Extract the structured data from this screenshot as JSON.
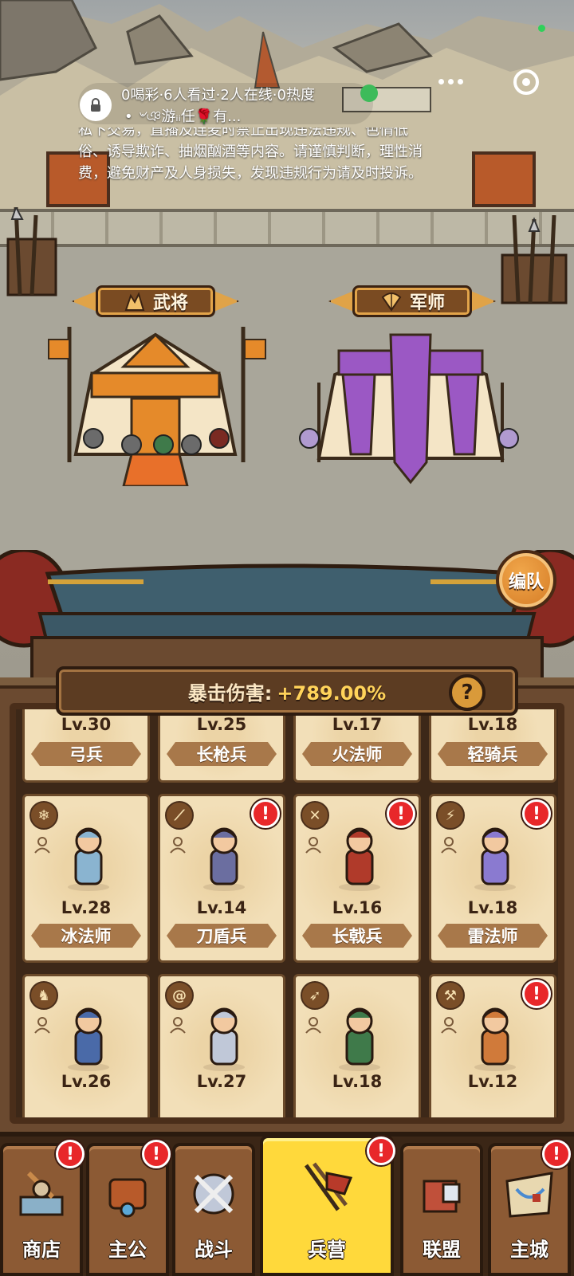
{
  "live": {
    "stats": "0喝彩·6人看过·2人在线·0热度",
    "sub": "• ৺ঞ游ᵢᵢ任🌹有...",
    "notice": "私下交易，直播及连麦时禁止出现违法违规、色情低俗、诱导欺诈、抽烟酗酒等内容。请谨慎判断，理性消费，避免财产及人身损失，发现违规行为请及时投诉。"
  },
  "scene": {
    "general_banner": "武将",
    "advisor_banner": "军师",
    "formation_button": "编队"
  },
  "crit": {
    "label": "暴击伤害:",
    "value": "+789.00%",
    "help": "?"
  },
  "units": [
    {
      "level": "Lv.30",
      "name": "弓兵"
    },
    {
      "level": "Lv.25",
      "name": "长枪兵"
    },
    {
      "level": "Lv.17",
      "name": "火法师"
    },
    {
      "level": "Lv.18",
      "name": "轻骑兵"
    },
    {
      "level": "Lv.28",
      "name": "冰法师",
      "type_icon": "snowflake-icon",
      "alert": false
    },
    {
      "level": "Lv.14",
      "name": "刀盾兵",
      "type_icon": "blade-icon",
      "alert": true
    },
    {
      "level": "Lv.16",
      "name": "长戟兵",
      "type_icon": "crossed-spears-icon",
      "alert": true
    },
    {
      "level": "Lv.18",
      "name": "雷法师",
      "type_icon": "lightning-icon",
      "alert": true
    },
    {
      "level": "Lv.26",
      "type_icon": "horse-icon",
      "alert": false
    },
    {
      "level": "Lv.27",
      "type_icon": "swirl-icon",
      "alert": false
    },
    {
      "level": "Lv.18",
      "type_icon": "crossbow-icon",
      "alert": false
    },
    {
      "level": "Lv.12",
      "type_icon": "axe-icon",
      "alert": true
    }
  ],
  "alert_mark": "!",
  "nav": [
    {
      "label": "商店",
      "icon": "shop-icon",
      "alert": true
    },
    {
      "label": "主公",
      "icon": "lord-icon",
      "alert": true
    },
    {
      "label": "战斗",
      "icon": "crossed-swords-icon",
      "alert": false
    },
    {
      "label": "兵营",
      "icon": "barracks-icon",
      "alert": true,
      "active": true
    },
    {
      "label": "联盟",
      "icon": "alliance-icon",
      "alert": false
    },
    {
      "label": "主城",
      "icon": "city-map-icon",
      "alert": true
    }
  ],
  "colors": {
    "accent": "#ffd93b",
    "alert": "#e8272a",
    "crit_value": "#ffd35a",
    "general_tent": "#e58a2a",
    "advisor_tent": "#9b58c4"
  }
}
